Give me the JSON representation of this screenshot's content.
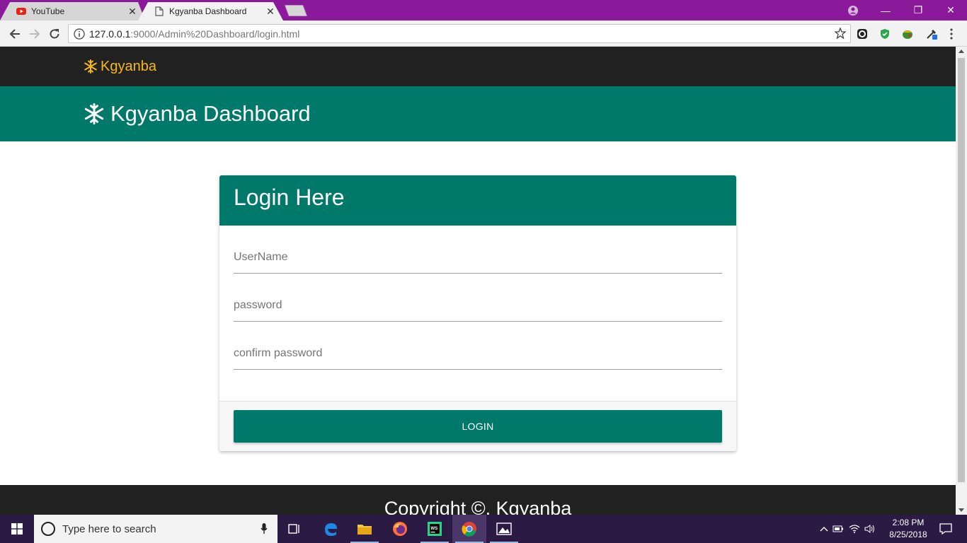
{
  "browser": {
    "tabs": [
      {
        "title": "YouTube"
      },
      {
        "title": "Kgyanba Dashboard"
      }
    ],
    "address": {
      "host": "127.0.0.1",
      "path": ":9000/Admin%20Dashboard/login.html"
    }
  },
  "site": {
    "brand": "Kgyanba",
    "banner_title": "Kgyanba Dashboard",
    "icon": "snowflake-icon"
  },
  "login": {
    "header": "Login Here",
    "fields": [
      {
        "placeholder": "UserName",
        "value": ""
      },
      {
        "placeholder": "password",
        "value": ""
      },
      {
        "placeholder": "confirm password",
        "value": ""
      }
    ],
    "button_label": "LOGIN"
  },
  "footer": {
    "text": "Copyright ©, Kgyanba"
  },
  "taskbar": {
    "search_placeholder": "Type here to search",
    "time": "2:08 PM",
    "date": "8/25/2018"
  },
  "colors": {
    "primary": "#00796b",
    "dark": "#212121",
    "brand_accent": "#f5b816",
    "tabstrip": "#8b1a9a"
  }
}
